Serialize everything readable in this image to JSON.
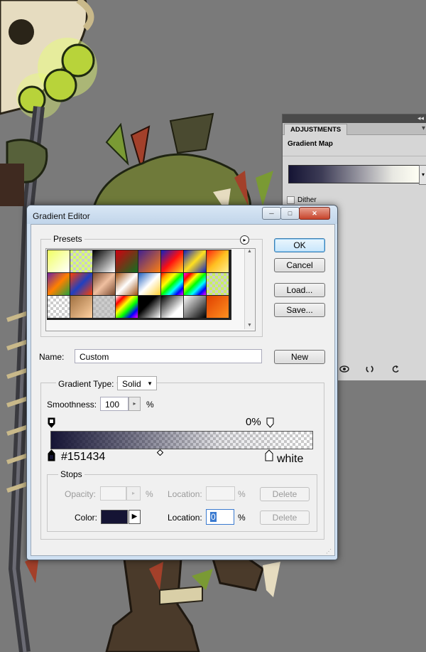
{
  "adjustments": {
    "tab_label": "ADJUSTMENTS",
    "collapse_glyph": "◂◂",
    "menu_glyph": "▾",
    "panel_title": "Gradient Map",
    "dropdown_glyph": "▾",
    "dither_label": "Dither",
    "gradient_colors": [
      "#151434",
      "#fffff4"
    ],
    "bottom_icons": [
      "eye-icon",
      "clip-icon",
      "reset-icon"
    ]
  },
  "dialog": {
    "title": "Gradient Editor",
    "window_buttons": {
      "minimize": "─",
      "maximize": "□",
      "close": "✕"
    },
    "presets_label": "Presets",
    "presets_menu_glyph": "▸",
    "scroll_up_glyph": "▲",
    "scroll_down_glyph": "▼",
    "buttons": {
      "ok": "OK",
      "cancel": "Cancel",
      "load": "Load...",
      "save": "Save...",
      "new": "New"
    },
    "name_label": "Name:",
    "name_value": "Custom",
    "gradient_type_label": "Gradient Type:",
    "gradient_type_value": "Solid",
    "gradient_type_arrow": "▼",
    "smoothness_label": "Smoothness:",
    "smoothness_value": "100",
    "smoothness_arrow": "▸",
    "smoothness_unit": "%",
    "opacity_stop_readout": "0%",
    "color_stop_left_readout": "#151434",
    "color_stop_right_readout": "white",
    "stops_label": "Stops",
    "opacity_label": "Opacity:",
    "opacity_unit": "%",
    "opacity_location_label": "Location:",
    "opacity_location_unit": "%",
    "opacity_delete": "Delete",
    "color_label": "Color:",
    "color_value": "#151434",
    "color_arrow": "▶",
    "color_location_label": "Location:",
    "color_location_value": "0",
    "color_location_unit": "%",
    "color_delete": "Delete"
  }
}
